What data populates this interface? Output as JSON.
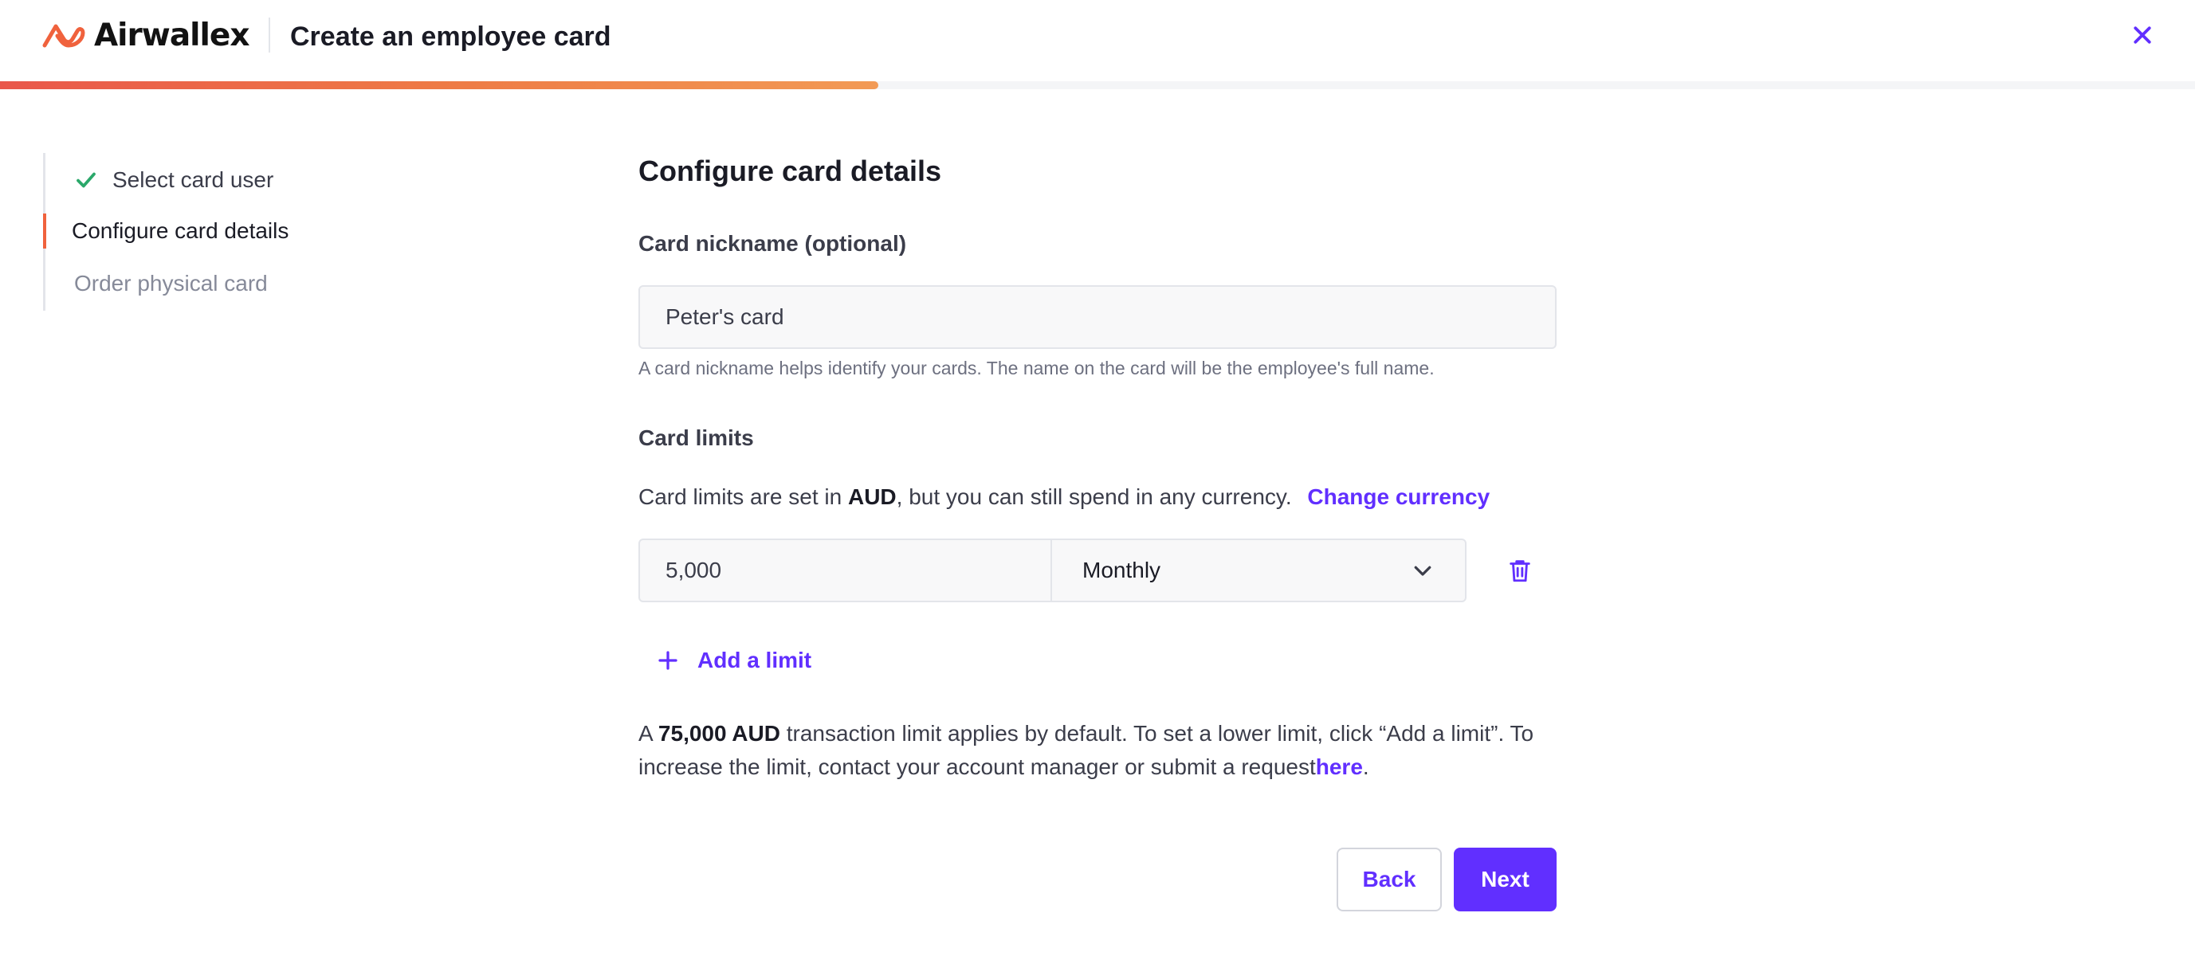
{
  "header": {
    "brand": "Airwallex",
    "title": "Create an employee card",
    "close_icon": "close-icon",
    "progress": 0.4,
    "accent_color": "#612fff",
    "brand_color": "#f0623d"
  },
  "stepper": {
    "steps": [
      {
        "label": "Select card user",
        "status": "done"
      },
      {
        "label": "Configure card details",
        "status": "active"
      },
      {
        "label": "Order physical card",
        "status": "pending"
      }
    ]
  },
  "form": {
    "title": "Configure card details",
    "nickname": {
      "label": "Card nickname (optional)",
      "value": "Peter's card",
      "help": "A card nickname helps identify your cards. The name on the card will be the employee's full name."
    },
    "limits": {
      "label": "Card limits",
      "desc_prefix": "Card limits are set in ",
      "currency": "AUD",
      "desc_suffix": ", but you can still spend in any currency.",
      "change_currency": "Change currency",
      "amount": "5,000",
      "period": "Monthly",
      "add_limit": "Add a limit"
    },
    "notice": {
      "prefix": "A ",
      "amount": "75,000 AUD",
      "middle": " transaction limit applies by default. To set a lower limit, click “Add a limit”. To increase the limit, contact your account manager or submit a request",
      "link": "here",
      "suffix": "."
    }
  },
  "actions": {
    "back": "Back",
    "next": "Next"
  }
}
